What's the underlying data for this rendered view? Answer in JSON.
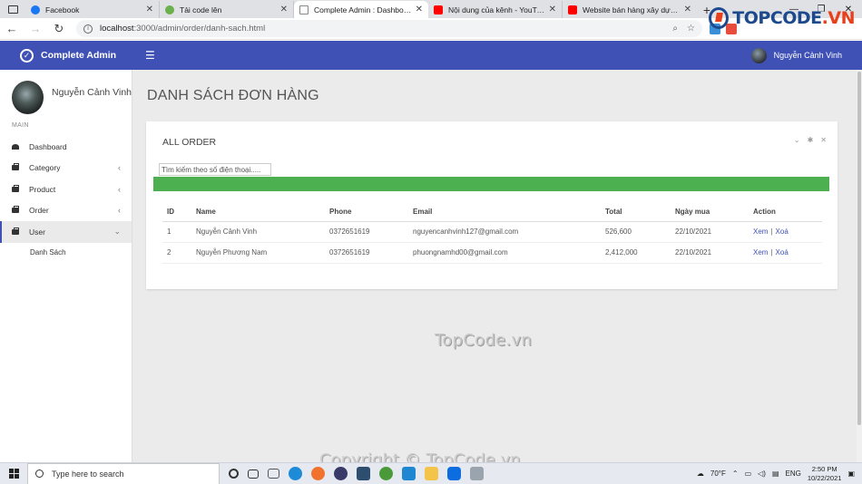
{
  "browser": {
    "tabs": [
      {
        "title": "Facebook",
        "fav_color": "#1877f2"
      },
      {
        "title": "Tải code lên",
        "fav_color": "#6ab04c"
      },
      {
        "title": "Complete Admin : Dashboard",
        "fav_color": "#888888",
        "active": true
      },
      {
        "title": "Nội dung của kênh - YouTube Stu",
        "fav_color": "#ff0000"
      },
      {
        "title": "Website bán hàng xây dựng bằn",
        "fav_color": "#ff0000"
      }
    ],
    "url_host": "localhost",
    "url_path": ":3000/admin/order/danh-sach.html"
  },
  "watermark_logo": {
    "text": "TOPCODE",
    "suffix": ".VN"
  },
  "app": {
    "brand": "Complete Admin",
    "header_user": "Nguyễn Cảnh Vinh"
  },
  "sidebar": {
    "profile_name": "Nguyễn Cảnh Vinh",
    "section_label": "MAIN",
    "items": [
      {
        "label": "Dashboard",
        "icon": "dashboard-icon"
      },
      {
        "label": "Category",
        "icon": "briefcase-icon"
      },
      {
        "label": "Product",
        "icon": "briefcase-icon"
      },
      {
        "label": "Order",
        "icon": "briefcase-icon"
      },
      {
        "label": "User",
        "icon": "briefcase-icon"
      }
    ],
    "sub_item": "Danh Sách"
  },
  "page": {
    "title": "DANH SÁCH ĐƠN HÀNG",
    "card_title": "ALL ORDER",
    "search_placeholder": "Tìm kiếm theo số điện thoại.....",
    "accent": "#4caf50",
    "brand_color": "#3f51b5"
  },
  "table": {
    "headers": [
      "ID",
      "Name",
      "Phone",
      "Email",
      "Total",
      "Ngày mua",
      "Action"
    ],
    "rows": [
      {
        "id": "1",
        "name": "Nguyễn Cảnh Vinh",
        "phone": "0372651619",
        "email": "nguyencanhvinh127@gmail.com",
        "total": "526,600",
        "date": "22/10/2021",
        "view": "Xem",
        "sep": "|",
        "del": "Xoá"
      },
      {
        "id": "2",
        "name": "Nguyễn Phương Nam",
        "phone": "0372651619",
        "email": "phuongnamhd00@gmail.com",
        "total": "2,412,000",
        "date": "22/10/2021",
        "view": "Xem",
        "sep": "|",
        "del": "Xoá"
      }
    ]
  },
  "watermarks": {
    "center": "TopCode.vn",
    "bottom": "Copyright © TopCode.vn"
  },
  "taskbar": {
    "search_placeholder": "Type here to search",
    "weather": "70°F",
    "lang": "ENG",
    "time": "2:50 PM",
    "date": "10/22/2021"
  }
}
